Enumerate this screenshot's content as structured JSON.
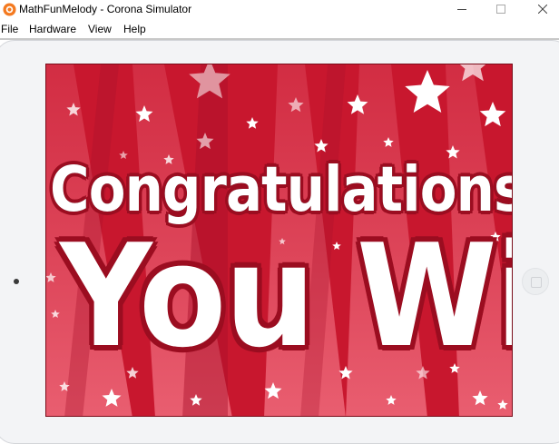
{
  "window": {
    "title": "MathFunMelody - Corona Simulator"
  },
  "menu": {
    "items": [
      "File",
      "Hardware",
      "View",
      "Help"
    ]
  },
  "screen": {
    "line1": "Congratulations",
    "line2": "You Win"
  },
  "colors": {
    "background_red": "#c8172e",
    "beam_light": "#e0485a",
    "text_white": "#ffffff",
    "text_outline": "#9b0d20",
    "star": "#ffffff"
  }
}
